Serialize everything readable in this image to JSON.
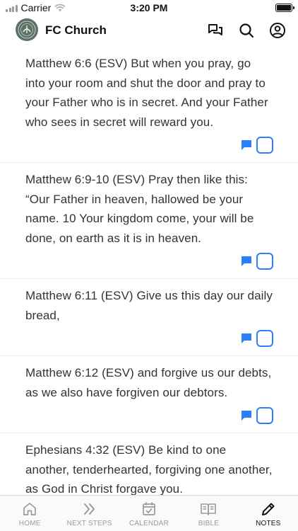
{
  "status_bar": {
    "carrier": "Carrier",
    "time": "3:20 PM"
  },
  "header": {
    "title": "FC Church",
    "icons": [
      "chat-bubbles-icon",
      "search-icon",
      "profile-icon"
    ]
  },
  "notes": [
    {
      "text": "Matthew 6:6 (ESV) But when you pray, go into your room and shut the door and pray to your Father who is in secret. And your Father who sees in secret will reward you."
    },
    {
      "text": "Matthew 6:9-10 (ESV) Pray then like this: “Our Father in heaven, hallowed be your name. 10 Your kingdom come, your will be done, on earth as it is in heaven."
    },
    {
      "text": "Matthew 6:11 (ESV) Give us this day our daily bread,"
    },
    {
      "text": "Matthew 6:12 (ESV) and forgive us our debts, as we also have forgiven our debtors."
    },
    {
      "text": "Ephesians 4:32 (ESV) Be kind to one another, tenderhearted, forgiving one another, as God in Christ forgave you."
    }
  ],
  "tabs": [
    {
      "label": "HOME",
      "icon": "home-icon",
      "active": false
    },
    {
      "label": "NEXT STEPS",
      "icon": "double-chevron-icon",
      "active": false
    },
    {
      "label": "CALENDAR",
      "icon": "calendar-icon",
      "active": false
    },
    {
      "label": "BIBLE",
      "icon": "bible-icon",
      "active": false
    },
    {
      "label": "NOTES",
      "icon": "pencil-icon",
      "active": true
    }
  ],
  "colors": {
    "accent": "#2d7ff9",
    "logo_bg": "#5b7266",
    "inactive_tab": "#9b9b9b",
    "active_tab": "#111111"
  }
}
